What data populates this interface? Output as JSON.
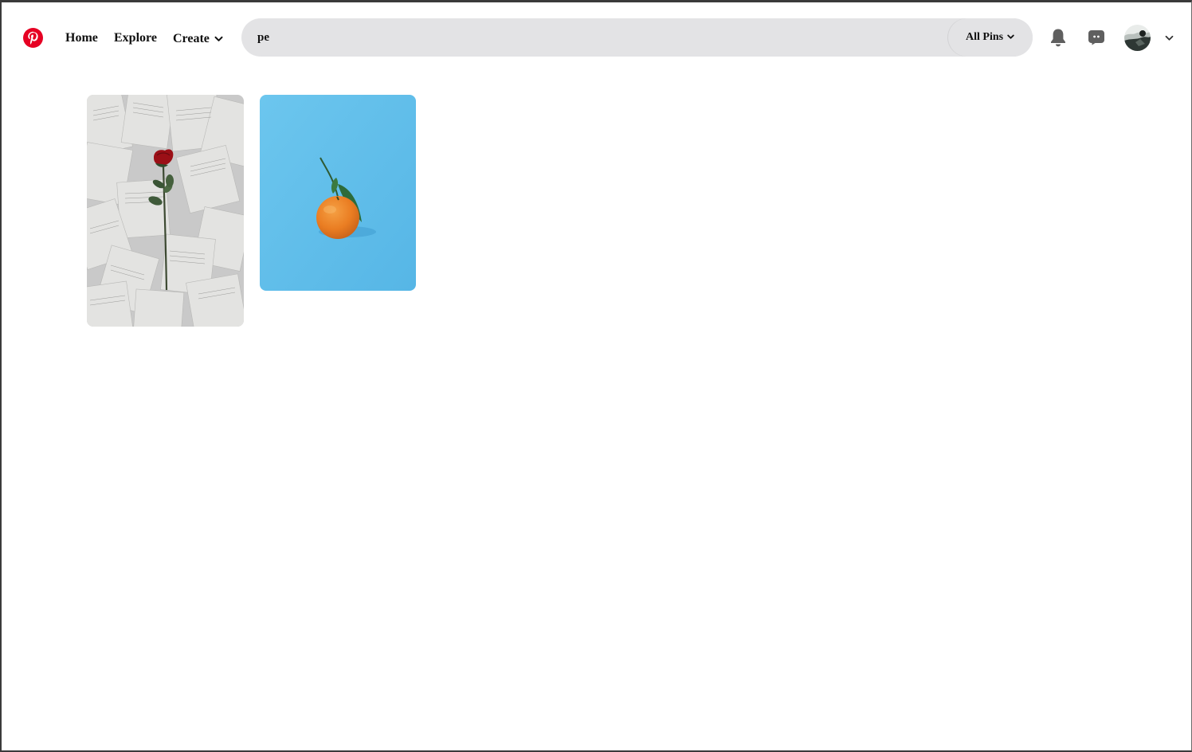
{
  "header": {
    "logo_icon": "pinterest-logo-icon",
    "brand_color": "#e60023",
    "nav": {
      "home_label": "Home",
      "explore_label": "Explore",
      "create_label": "Create"
    },
    "search": {
      "value": "pe",
      "placeholder": "Search",
      "filter_label": "All Pins"
    },
    "icons": {
      "notifications": "bell-icon",
      "messages": "chat-icon",
      "account_menu": "chevron-down-icon"
    }
  },
  "pins": [
    {
      "subject": "red rose on scattered book pages",
      "background_color": "#cfcfcf"
    },
    {
      "subject": "tangerine with green leaves",
      "background_color": "#5fbde9"
    }
  ]
}
